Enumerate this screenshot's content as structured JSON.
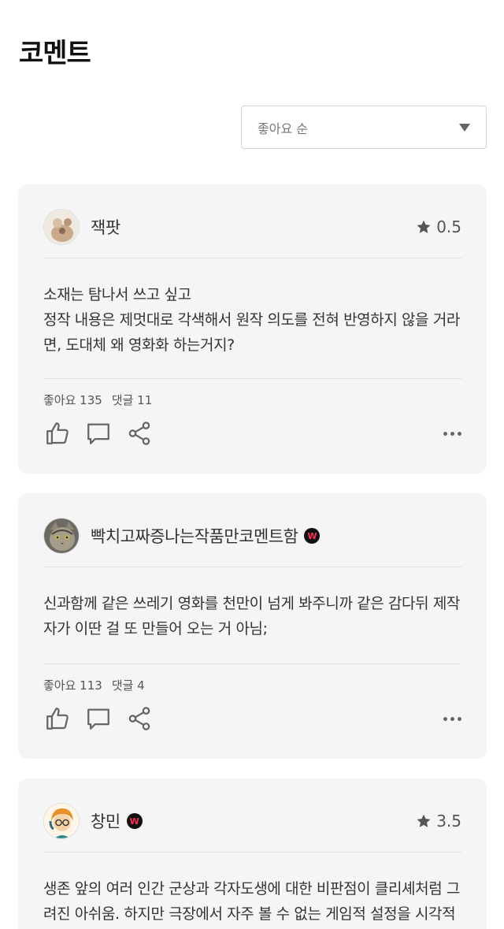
{
  "page": {
    "title": "코멘트"
  },
  "sort": {
    "selected": "좋아요 순"
  },
  "comments": [
    {
      "username": "잭팟",
      "badge": "",
      "rating": "0.5",
      "text": "소재는 탐나서 쓰고 싶고\n정작 내용은 제멋대로 각색해서 원작 의도를 전혀 반영하지 않을 거라면, 도대체 왜 영화화 하는거지?",
      "likes": "좋아요 135",
      "replies": "댓글 11"
    },
    {
      "username": "빡치고짜증나는작품만코멘트함",
      "badge": "W",
      "rating": "",
      "text": "신과함께 같은 쓰레기 영화를 천만이 넘게 봐주니까 같은 감다뒤 제작자가 이딴 걸 또 만들어 오는 거 아님;",
      "likes": "좋아요 113",
      "replies": "댓글 4"
    },
    {
      "username": "창민",
      "badge": "W",
      "rating": "3.5",
      "text": "생존 앞의 여러 인간 군상과 각자도생에 대한 비판점이 클리셰처럼 그려진 아쉬움. 하지만 극장에서 자주 볼 수 없는 게임적 설정을 시각적으로 구현한 점은 흥미로웠다.",
      "likes": "",
      "replies": ""
    }
  ],
  "icons": {
    "star": "star-icon",
    "like": "thumbs-up-icon",
    "reply": "speech-bubble-icon",
    "share": "share-icon",
    "more": "more-dots-icon",
    "caret": "chevron-down-icon"
  },
  "colors": {
    "card_bg": "#f5f5f6",
    "badge_bg": "#111111",
    "badge_fg": "#ff2d55"
  }
}
